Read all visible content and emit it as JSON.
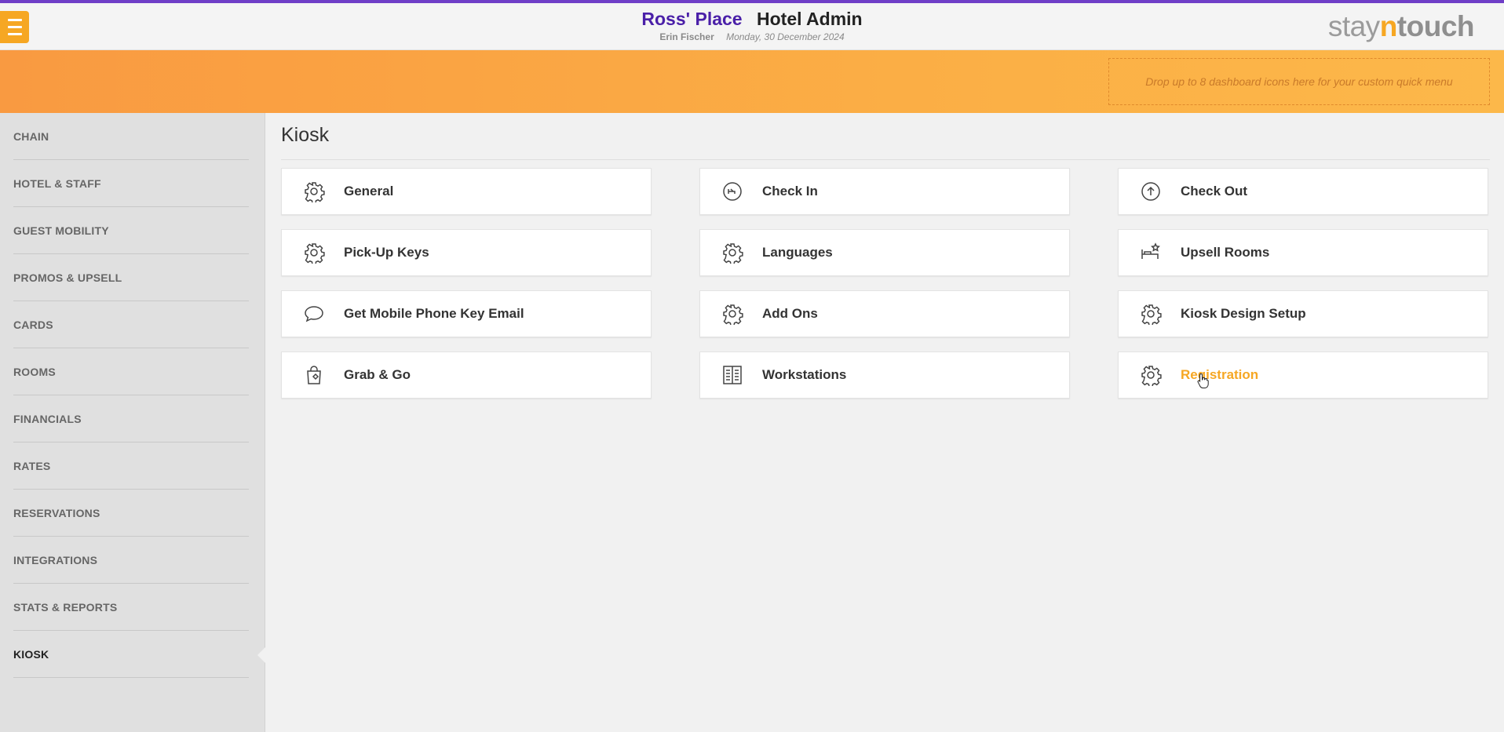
{
  "header": {
    "hotel_name": "Ross' Place",
    "app_name": "Hotel Admin",
    "user_name": "Erin Fischer",
    "date": "Monday, 30 December 2024",
    "brand": {
      "part1": "stay",
      "part2": "n",
      "part3": "touch"
    },
    "accent_color": "#6f3ec7",
    "brand_orange": "#f6a723"
  },
  "banner": {
    "quick_menu_placeholder": "Drop up to 8 dashboard icons here for your custom quick menu"
  },
  "sidebar": {
    "items": [
      {
        "label": "CHAIN"
      },
      {
        "label": "HOTEL & STAFF"
      },
      {
        "label": "GUEST MOBILITY"
      },
      {
        "label": "PROMOS & UPSELL"
      },
      {
        "label": "CARDS"
      },
      {
        "label": "ROOMS"
      },
      {
        "label": "FINANCIALS"
      },
      {
        "label": "RATES"
      },
      {
        "label": "RESERVATIONS"
      },
      {
        "label": "INTEGRATIONS"
      },
      {
        "label": "STATS & REPORTS"
      },
      {
        "label": "KIOSK",
        "active": true
      }
    ]
  },
  "main": {
    "title": "Kiosk",
    "tiles": [
      {
        "label": "General",
        "icon": "gear-icon"
      },
      {
        "label": "Check In",
        "icon": "check-in-icon"
      },
      {
        "label": "Check Out",
        "icon": "check-out-icon"
      },
      {
        "label": "Pick-Up Keys",
        "icon": "gear-icon"
      },
      {
        "label": "Languages",
        "icon": "gear-icon"
      },
      {
        "label": "Upsell Rooms",
        "icon": "upsell-bed-icon"
      },
      {
        "label": "Get Mobile Phone Key Email",
        "icon": "chat-bubble-icon"
      },
      {
        "label": "Add Ons",
        "icon": "gear-icon"
      },
      {
        "label": "Kiosk Design Setup",
        "icon": "gear-icon"
      },
      {
        "label": "Grab & Go",
        "icon": "shopping-bag-icon"
      },
      {
        "label": "Workstations",
        "icon": "workstation-icon"
      },
      {
        "label": "Registration",
        "icon": "gear-icon",
        "hovered": true
      }
    ]
  }
}
